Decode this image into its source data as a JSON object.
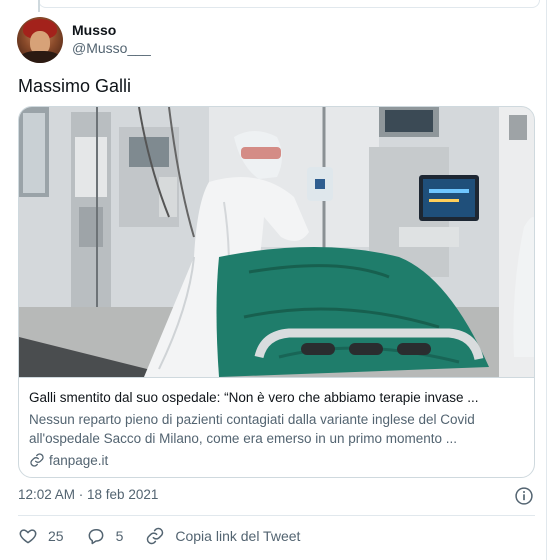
{
  "author": {
    "display_name": "Musso",
    "handle": "@Musso___"
  },
  "tweet": {
    "text": "Massimo Galli",
    "timestamp": "12:02 AM · 18 feb 2021"
  },
  "card": {
    "title": "Galli smentito dal suo ospedale: “Non è vero che abbiamo terapie invase ...",
    "description": "Nessun reparto pieno di pazienti contagiati dalla variante inglese del Covid all'ospedale Sacco di Milano, come era emerso in un primo momento ...",
    "domain": "fanpage.it"
  },
  "actions": {
    "likes": "25",
    "replies": "5",
    "copy_link": "Copia link del Tweet"
  },
  "icons": {
    "like": "heart-icon",
    "reply": "reply-icon",
    "copy_link": "link-icon",
    "domain": "link-icon",
    "info": "info-icon"
  },
  "colors": {
    "text_primary": "#0f1419",
    "text_secondary": "#536471",
    "border": "#cfd9de"
  }
}
